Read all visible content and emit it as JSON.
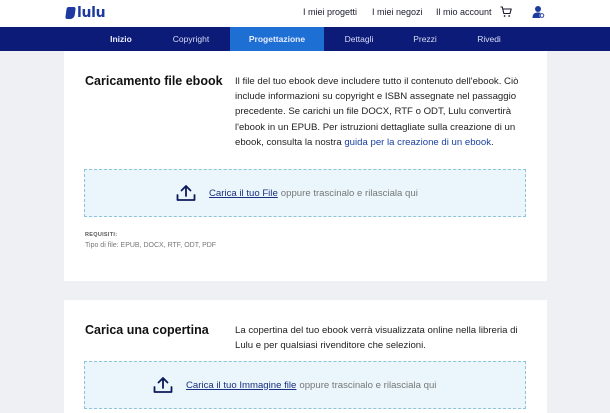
{
  "header": {
    "logo_text": "lulu",
    "links": [
      "I miei progetti",
      "I miei negozi",
      "Il mio account"
    ],
    "icons": [
      "cart-icon",
      "user-account-icon"
    ]
  },
  "nav": {
    "items": [
      "Inizio",
      "Copyright",
      "Progettazione",
      "Dettagli",
      "Prezzi",
      "Rivedi"
    ],
    "active": "Progettazione"
  },
  "ebook_upload": {
    "title": "Caricamento file ebook",
    "body": "Il file del tuo ebook deve includere tutto il contenuto dell'ebook. Ciò include informazioni su copyright e ISBN assegnate nel passaggio precedente. Se carichi un file DOCX, RTF o ODT, Lulu convertirà l'ebook in un EPUB. Per istruzioni dettagliate sulla creazione di un ebook, consulta la nostra",
    "body_link": "guida per la creazione di un ebook",
    "body_end": ".",
    "dropzone_link": "Carica il tuo File",
    "dropzone_text": "oppure trascinalo e rilasciala qui",
    "requirements_label": "REQUISITI:",
    "requirements_value": "Tipo di file: EPUB, DOCX, RTF, ODT, PDF"
  },
  "cover_upload": {
    "title": "Carica una copertina",
    "body": "La copertina del tuo ebook verrà visualizzata online nella libreria di Lulu e per qualsiasi rivenditore che selezioni.",
    "dropzone_link": "Carica il tuo Immagine file",
    "dropzone_text": "oppure trascinalo e rilasciala qui"
  },
  "colors": {
    "nav_bg": "#0c1a78",
    "nav_active": "#1d6fd3",
    "brand": "#1e3a9e",
    "dropzone_bg": "#eaf6fb",
    "dropzone_border": "#8fc3da",
    "page_bg": "#eef0f4"
  }
}
